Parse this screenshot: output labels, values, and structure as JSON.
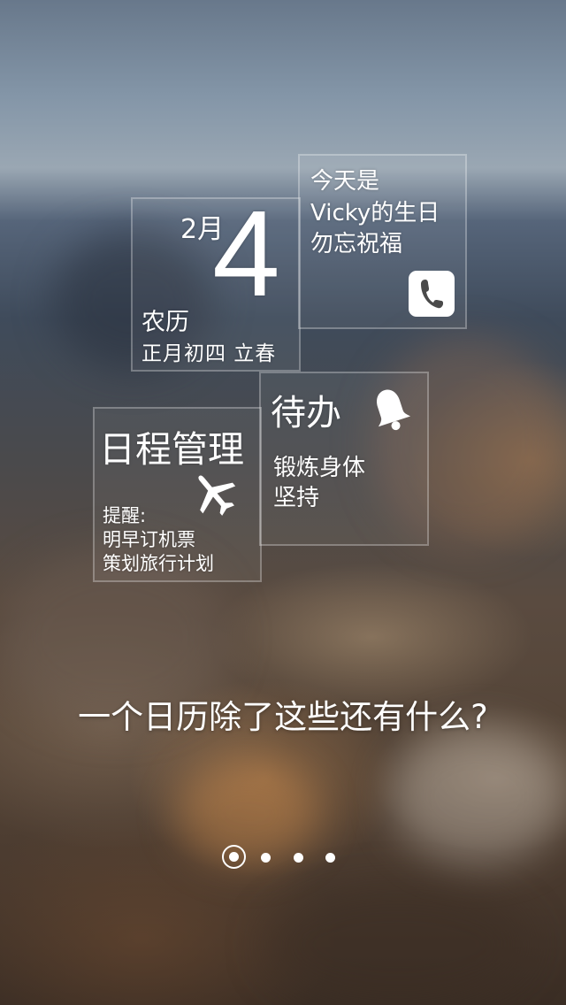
{
  "date_tile": {
    "month": "2月",
    "day": "4",
    "lunar_label": "农历",
    "lunar_date": "正月初四 立春"
  },
  "birthday_tile": {
    "line1": "今天是",
    "line2": "Vicky的生日",
    "line3": "勿忘祝福",
    "action_icon": "phone-icon"
  },
  "todo_tile": {
    "title": "待办",
    "icon": "bell-icon",
    "items": [
      "锻炼身体",
      "坚持"
    ]
  },
  "schedule_tile": {
    "title": "日程管理",
    "icon": "airplane-icon",
    "reminder_label": "提醒:",
    "items": [
      "明早订机票",
      "策划旅行计划"
    ]
  },
  "tagline": "一个日历除了这些还有什么?",
  "pager": {
    "total": 4,
    "active_index": 0
  },
  "colors": {
    "text": "#ffffff",
    "tile_border": "rgba(255,255,255,0.28)"
  }
}
